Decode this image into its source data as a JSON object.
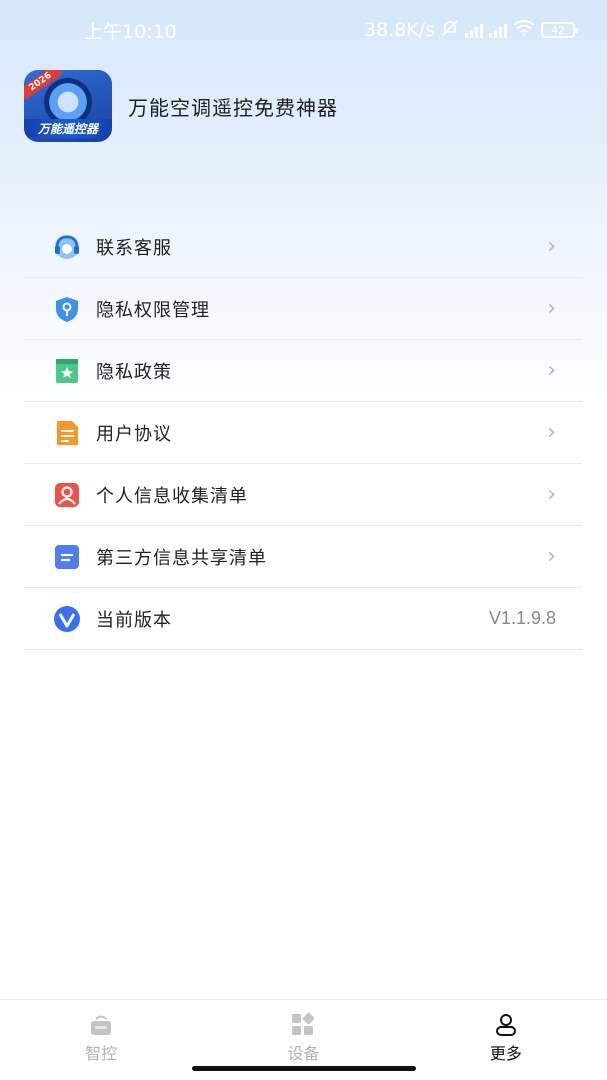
{
  "status_bar": {
    "time": "上午10:10",
    "net_speed": "38.8K/s",
    "battery": "42"
  },
  "app": {
    "title": "万能空调遥控免费神器",
    "logo_badge": "2026",
    "logo_text": "万能遥控器"
  },
  "menu": {
    "items": [
      {
        "label": "联系客服",
        "icon": "headset-icon"
      },
      {
        "label": "隐私权限管理",
        "icon": "shield-key-icon"
      },
      {
        "label": "隐私政策",
        "icon": "bookmark-star-icon"
      },
      {
        "label": "用户协议",
        "icon": "document-icon"
      },
      {
        "label": "个人信息收集清单",
        "icon": "person-icon"
      },
      {
        "label": "第三方信息共享清单",
        "icon": "list-icon"
      },
      {
        "label": "当前版本",
        "icon": "version-icon",
        "value": "V1.1.9.8"
      }
    ]
  },
  "bottom_nav": {
    "tabs": [
      {
        "label": "智控",
        "icon": "router-icon",
        "active": false
      },
      {
        "label": "设备",
        "icon": "devices-grid-icon",
        "active": false
      },
      {
        "label": "更多",
        "icon": "profile-icon",
        "active": true
      }
    ]
  },
  "colors": {
    "accent": "#3b82f6",
    "header_gradient_top": "#d6e7fb"
  }
}
